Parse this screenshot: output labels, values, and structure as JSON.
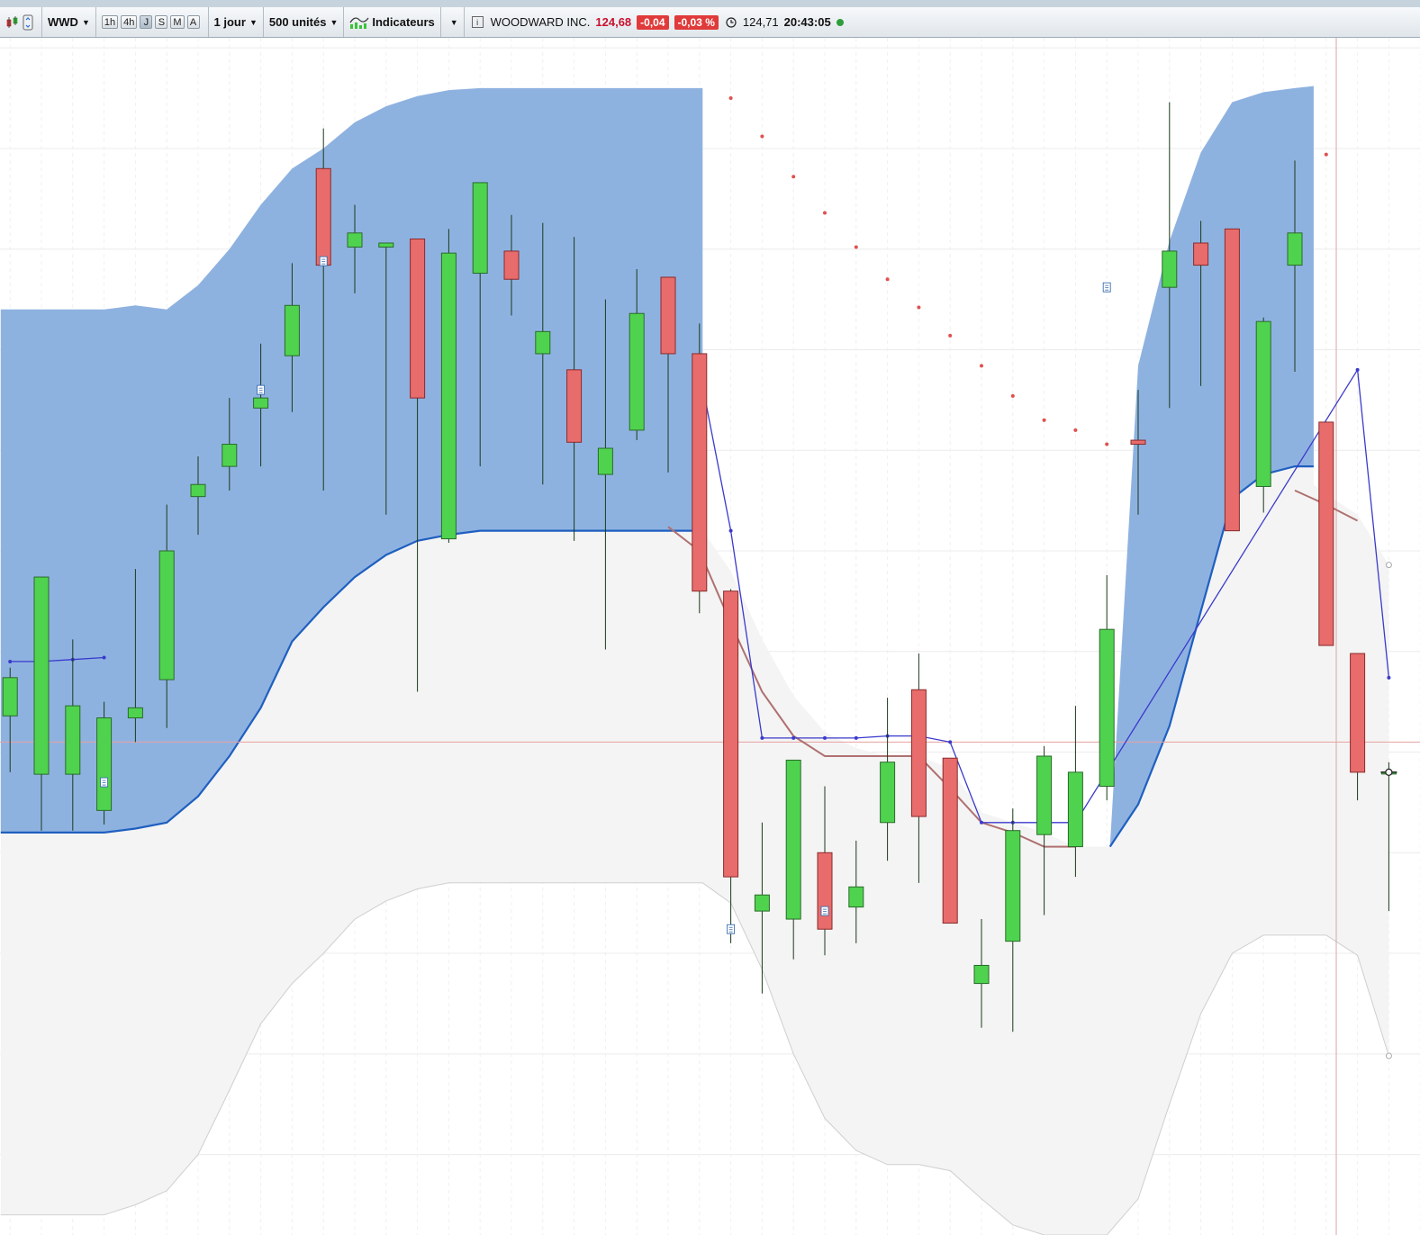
{
  "toolbar": {
    "symbol": "WWD",
    "periods": [
      "1h",
      "4h",
      "J",
      "S",
      "M",
      "A"
    ],
    "active_period": "J",
    "interval": "1 jour",
    "units": "500 unités",
    "indicators_label": "Indicateurs",
    "instrument": "WOODWARD INC.",
    "last_price": "124,68",
    "change": "-0,04",
    "change_pct": "-0,03 %",
    "time_price": "124,71",
    "time": "20:43:05"
  },
  "colors": {
    "up_candle": "#4fd34f",
    "down_candle": "#e86c6c",
    "cloud_bull": "#8eb2e0",
    "cloud_base": "#f4f4f4",
    "upper_line": "#1f5fc0",
    "mid_line": "#b07070",
    "psar": "#e05050",
    "trend_line": "#3a3acc",
    "price_line": "#e8a0a0"
  },
  "chart_data": {
    "type": "candlestick",
    "y_scale": "linear",
    "ylim": [
      101.0,
      160.5
    ],
    "grid": true,
    "candles": [
      {
        "i": -1,
        "o": 126.8,
        "h": 129.2,
        "l": 124.0,
        "c": 128.7
      },
      {
        "i": 0,
        "o": 123.9,
        "h": 130.6,
        "l": 121.1,
        "c": 133.7
      },
      {
        "i": 1,
        "o": 123.9,
        "h": 130.6,
        "l": 121.1,
        "c": 127.3
      },
      {
        "i": 2,
        "o": 122.1,
        "h": 127.5,
        "l": 121.4,
        "c": 126.7
      },
      {
        "i": 3,
        "o": 126.7,
        "h": 134.1,
        "l": 125.5,
        "c": 127.2
      },
      {
        "i": 4,
        "o": 128.6,
        "h": 137.3,
        "l": 126.2,
        "c": 135.0
      },
      {
        "i": 5,
        "o": 137.7,
        "h": 139.7,
        "l": 135.8,
        "c": 138.3
      },
      {
        "i": 6,
        "o": 139.2,
        "h": 142.6,
        "l": 138.0,
        "c": 140.3
      },
      {
        "i": 7,
        "o": 142.1,
        "h": 145.3,
        "l": 139.2,
        "c": 142.6
      },
      {
        "i": 8,
        "o": 144.7,
        "h": 149.3,
        "l": 141.9,
        "c": 147.2
      },
      {
        "i": 9,
        "o": 154.0,
        "h": 156.0,
        "l": 138.0,
        "c": 149.2
      },
      {
        "i": 10,
        "o": 150.1,
        "h": 152.2,
        "l": 147.8,
        "c": 150.8
      },
      {
        "i": 11,
        "o": 150.1,
        "h": 150.3,
        "l": 136.8,
        "c": 150.3
      },
      {
        "i": 12,
        "o": 150.5,
        "h": 149.8,
        "l": 128.0,
        "c": 142.6
      },
      {
        "i": 13,
        "o": 135.6,
        "h": 151.0,
        "l": 135.4,
        "c": 149.8
      },
      {
        "i": 14,
        "o": 148.8,
        "h": 152.8,
        "l": 139.2,
        "c": 153.3
      },
      {
        "i": 15,
        "o": 149.9,
        "h": 151.7,
        "l": 146.7,
        "c": 148.5
      },
      {
        "i": 16,
        "o": 144.8,
        "h": 151.3,
        "l": 138.3,
        "c": 145.9
      },
      {
        "i": 17,
        "o": 144.0,
        "h": 150.6,
        "l": 135.5,
        "c": 140.4
      },
      {
        "i": 18,
        "o": 138.8,
        "h": 147.5,
        "l": 130.1,
        "c": 140.1
      },
      {
        "i": 19,
        "o": 141.0,
        "h": 149.0,
        "l": 140.5,
        "c": 146.8
      },
      {
        "i": 20,
        "o": 148.6,
        "h": 148.2,
        "l": 138.9,
        "c": 144.8
      },
      {
        "i": 21,
        "o": 144.8,
        "h": 146.3,
        "l": 131.9,
        "c": 133.0
      },
      {
        "i": 22,
        "o": 133.0,
        "h": 133.1,
        "l": 115.5,
        "c": 118.8
      },
      {
        "i": 23,
        "o": 117.1,
        "h": 121.5,
        "l": 113.0,
        "c": 117.9
      },
      {
        "i": 24,
        "o": 116.7,
        "h": 122.2,
        "l": 114.7,
        "c": 124.6
      },
      {
        "i": 25,
        "o": 120.0,
        "h": 123.3,
        "l": 114.9,
        "c": 116.2
      },
      {
        "i": 26,
        "o": 117.3,
        "h": 120.6,
        "l": 115.5,
        "c": 118.3
      },
      {
        "i": 27,
        "o": 121.5,
        "h": 127.7,
        "l": 119.6,
        "c": 124.5
      },
      {
        "i": 28,
        "o": 128.1,
        "h": 129.9,
        "l": 118.5,
        "c": 121.8
      },
      {
        "i": 29,
        "o": 124.7,
        "h": 120.5,
        "l": 116.8,
        "c": 116.5
      },
      {
        "i": 30,
        "o": 113.5,
        "h": 116.7,
        "l": 111.3,
        "c": 114.4
      },
      {
        "i": 31,
        "o": 115.6,
        "h": 122.2,
        "l": 111.1,
        "c": 121.1
      },
      {
        "i": 32,
        "o": 120.9,
        "h": 125.3,
        "l": 116.9,
        "c": 124.8
      },
      {
        "i": 33,
        "o": 120.3,
        "h": 127.3,
        "l": 118.8,
        "c": 124.0
      },
      {
        "i": 34,
        "o": 123.3,
        "h": 133.8,
        "l": 122.6,
        "c": 131.1
      },
      {
        "i": 35,
        "o": 140.5,
        "h": 143.0,
        "l": 136.8,
        "c": 140.3
      },
      {
        "i": 36,
        "o": 148.1,
        "h": 157.3,
        "l": 142.1,
        "c": 149.9
      },
      {
        "i": 37,
        "o": 150.3,
        "h": 151.4,
        "l": 143.2,
        "c": 149.2
      },
      {
        "i": 38,
        "o": 151.0,
        "h": 148.0,
        "l": 136.4,
        "c": 136.0
      },
      {
        "i": 39,
        "o": 138.2,
        "h": 146.6,
        "l": 136.9,
        "c": 146.4
      },
      {
        "i": 40,
        "o": 149.2,
        "h": 154.4,
        "l": 143.9,
        "c": 150.8
      },
      {
        "i": 41,
        "o": 141.4,
        "h": 138.5,
        "l": 131.0,
        "c": 130.3
      },
      {
        "i": 42,
        "o": 129.9,
        "h": 128.7,
        "l": 122.6,
        "c": 124.0
      },
      {
        "i": 43,
        "o": 124.0,
        "h": 124.5,
        "l": 117.1,
        "c": 124.0
      }
    ],
    "cloud": {
      "span_a": [
        [
          -1.3,
          147.0
        ],
        [
          0,
          147.0
        ],
        [
          1,
          147.0
        ],
        [
          2,
          147.0
        ],
        [
          3,
          147.2
        ],
        [
          4,
          147.0
        ],
        [
          5,
          148.2
        ],
        [
          6,
          150.0
        ],
        [
          7,
          152.2
        ],
        [
          8,
          154.0
        ],
        [
          9,
          155.0
        ],
        [
          10,
          156.3
        ],
        [
          11,
          157.1
        ],
        [
          12,
          157.6
        ],
        [
          13,
          157.9
        ],
        [
          14,
          158.0
        ],
        [
          19,
          158.0
        ],
        [
          20,
          158.0
        ],
        [
          21.1,
          158.0
        ]
      ],
      "span_b": [
        [
          -1.3,
          121.0
        ],
        [
          0,
          121.0
        ],
        [
          1,
          121.0
        ],
        [
          2,
          121.0
        ],
        [
          3,
          121.2
        ],
        [
          4,
          121.5
        ],
        [
          5,
          122.8
        ],
        [
          6,
          124.8
        ],
        [
          7,
          127.2
        ],
        [
          8,
          130.5
        ],
        [
          9,
          132.2
        ],
        [
          10,
          133.7
        ],
        [
          11,
          134.8
        ],
        [
          12,
          135.5
        ],
        [
          13,
          135.8
        ],
        [
          14,
          136.0
        ],
        [
          19,
          136.0
        ],
        [
          20,
          136.0
        ],
        [
          21.1,
          136.0
        ]
      ],
      "span_a2": [
        [
          34.1,
          120.3
        ],
        [
          35,
          122.4
        ],
        [
          36,
          126.3
        ],
        [
          37,
          132.0
        ],
        [
          38,
          137.6
        ],
        [
          39,
          138.8
        ],
        [
          40,
          139.2
        ],
        [
          40.6,
          139.2
        ]
      ],
      "span_b2": [
        [
          34.1,
          120.3
        ],
        [
          35,
          144.2
        ],
        [
          36,
          150.4
        ],
        [
          37,
          154.8
        ],
        [
          38,
          157.3
        ],
        [
          39,
          157.8
        ],
        [
          40,
          158.0
        ],
        [
          40.6,
          158.1
        ]
      ]
    },
    "band": {
      "upper": [
        [
          21.1,
          136.0
        ],
        [
          22,
          134.0
        ],
        [
          23,
          130.6
        ],
        [
          24,
          127.8
        ],
        [
          25,
          126.0
        ],
        [
          26,
          125.2
        ],
        [
          27,
          124.8
        ],
        [
          28,
          124.8
        ],
        [
          29,
          124.2
        ],
        [
          30,
          122.0
        ],
        [
          31,
          121.5
        ],
        [
          32,
          121.0
        ],
        [
          33,
          120.3
        ],
        [
          34,
          120.3
        ]
      ],
      "lower": [
        [
          -1.3,
          102.0
        ],
        [
          0,
          102.0
        ],
        [
          1,
          102.0
        ],
        [
          2,
          102.0
        ],
        [
          3,
          102.5
        ],
        [
          4,
          103.2
        ],
        [
          5,
          105.0
        ],
        [
          6,
          108.2
        ],
        [
          7,
          111.5
        ],
        [
          8,
          113.5
        ],
        [
          9,
          115.0
        ],
        [
          10,
          116.7
        ],
        [
          11,
          117.6
        ],
        [
          12,
          118.2
        ],
        [
          13,
          118.5
        ],
        [
          14,
          118.5
        ],
        [
          19,
          118.5
        ],
        [
          20,
          118.5
        ],
        [
          21.1,
          118.5
        ],
        [
          22,
          117.5
        ],
        [
          23,
          114.2
        ],
        [
          24,
          110.0
        ],
        [
          25,
          106.8
        ],
        [
          26,
          105.2
        ],
        [
          27,
          104.5
        ],
        [
          28,
          104.5
        ],
        [
          29,
          104.2
        ],
        [
          30,
          102.8
        ],
        [
          31,
          101.5
        ],
        [
          32,
          101.0
        ],
        [
          33,
          101.0
        ],
        [
          34,
          101.0
        ],
        [
          35,
          102.8
        ],
        [
          36,
          107.5
        ],
        [
          37,
          112.0
        ],
        [
          38,
          115.0
        ],
        [
          39,
          115.9
        ],
        [
          40,
          115.9
        ],
        [
          41,
          115.9
        ],
        [
          42,
          114.9
        ],
        [
          43,
          109.9
        ]
      ],
      "upper_end": [
        [
          40.6,
          138.3
        ],
        [
          41,
          137.8
        ],
        [
          42,
          136.8
        ],
        [
          43,
          134.3
        ]
      ]
    },
    "mid_line": [
      [
        20,
        136.2
      ],
      [
        21,
        135.0
      ],
      [
        22,
        131.4
      ],
      [
        23,
        128.0
      ],
      [
        24,
        125.8
      ],
      [
        25,
        124.8
      ],
      [
        26,
        124.8
      ],
      [
        27,
        124.8
      ],
      [
        28,
        124.8
      ],
      [
        29,
        123.2
      ],
      [
        30,
        121.5
      ],
      [
        31,
        121.0
      ],
      [
        32,
        120.3
      ],
      [
        33,
        120.3
      ],
      [
        40,
        138.0
      ],
      [
        41,
        137.3
      ],
      [
        42,
        136.5
      ]
    ],
    "trend_line": [
      [
        -1,
        129.5
      ],
      [
        0,
        129.5
      ],
      [
        1,
        129.6
      ],
      [
        2,
        129.7
      ],
      [
        21,
        144.0
      ],
      [
        22,
        136.0
      ],
      [
        23,
        125.7
      ],
      [
        24,
        125.7
      ],
      [
        25,
        125.7
      ],
      [
        26,
        125.7
      ],
      [
        27,
        125.8
      ],
      [
        28,
        125.8
      ],
      [
        29,
        125.5
      ],
      [
        30,
        121.5
      ],
      [
        31,
        121.5
      ],
      [
        32,
        121.5
      ],
      [
        33,
        121.5
      ],
      [
        42,
        144.0
      ],
      [
        43,
        128.7
      ]
    ],
    "psar": [
      [
        22,
        157.5
      ],
      [
        23,
        155.6
      ],
      [
        24,
        153.6
      ],
      [
        25,
        151.8
      ],
      [
        26,
        150.1
      ],
      [
        27,
        148.5
      ],
      [
        28,
        147.1
      ],
      [
        29,
        145.7
      ],
      [
        30,
        144.2
      ],
      [
        31,
        142.7
      ],
      [
        32,
        141.5
      ],
      [
        33,
        141.0
      ],
      [
        34,
        140.3
      ],
      [
        41,
        154.7
      ]
    ],
    "last_price": 125.5,
    "cursor": {
      "i": 43,
      "price": 124.0
    }
  }
}
